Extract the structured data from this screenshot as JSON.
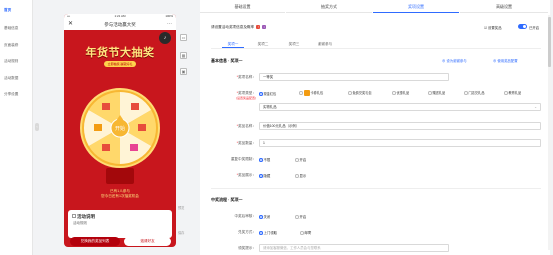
{
  "sidebar": {
    "items": [
      {
        "label": "首页",
        "active": true
      },
      {
        "label": "基础信息"
      },
      {
        "label": "页面装修"
      },
      {
        "label": "活动规则"
      },
      {
        "label": "活动数据"
      },
      {
        "label": "分享设置"
      }
    ]
  },
  "phone": {
    "time": "1:21 AM",
    "battery": "100%",
    "nav_title": "参与活动赢大奖",
    "banner_title": "年货节大抽奖",
    "banner_sub": "立即抽奖 赢取好礼",
    "wheel_center": "开始",
    "prize_line1": "已有1人参与",
    "prize_line2": "您今日还有1次抽奖机会",
    "rules_title": "活动说明",
    "rules_sub": "活动规则",
    "btn_primary": "兑换我的奖品列表",
    "btn_secondary": "邀请好友"
  },
  "tools": {
    "labels": [
      "预览",
      "保存"
    ]
  },
  "tabs": [
    {
      "label": "基础设置"
    },
    {
      "label": "抽奖方式"
    },
    {
      "label": "奖项设置",
      "active": true
    },
    {
      "label": "高级设置"
    }
  ],
  "notice": {
    "text": "请设置活动奖项信息及概率",
    "checkbox_label": "设置奖品",
    "toggle_label": "已开启"
  },
  "prize_tabs": [
    {
      "label": "奖项一",
      "active": true
    },
    {
      "label": "奖项二"
    },
    {
      "label": "奖项三"
    },
    {
      "label": "谢谢参与"
    }
  ],
  "section1": {
    "title": "基本信息 · 奖项一",
    "link_set_default": "设为谢谢参与",
    "link_use_config": "使用奖品配置",
    "fields": {
      "name_label": "奖项名称：",
      "name_value": "一等奖",
      "type_label": "奖项类型：",
      "type_hint": "(设置奖品配置)",
      "type_options": [
        {
          "label": "现金红包",
          "on": true,
          "color": "#e74c3c"
        },
        {
          "label": "卡券礼包",
          "color": "#f39c12"
        },
        {
          "label": "免费兑奖礼包",
          "color": "#f39c12"
        },
        {
          "label": "优惠礼品",
          "color": "#e67e22"
        },
        {
          "label": "赠送礼品",
          "color": "#3498db"
        },
        {
          "label": "门店兑礼品",
          "color": "#2ecc71"
        },
        {
          "label": "教育礼品",
          "color": "#9b59b6"
        }
      ],
      "select_value": "实物礼品",
      "reward_label": "奖品名称：",
      "reward_value": "价值100元礼品（示例）",
      "qty_label": "奖品数量：",
      "qty_value": "1",
      "limit_label": "重复中奖限制：",
      "limit_options": [
        {
          "label": "不限",
          "on": true
        },
        {
          "label": "开启"
        }
      ],
      "show_label": "奖品展示：",
      "show_options": [
        {
          "label": "隐藏",
          "on": true
        },
        {
          "label": "显示"
        }
      ]
    }
  },
  "section2": {
    "title": "中奖流程 · 奖项一",
    "fields": {
      "review_label": "中奖后审核：",
      "review_options": [
        {
          "label": "关闭",
          "on": true
        },
        {
          "label": "开启"
        }
      ],
      "method_label": "兑奖方式：",
      "method_options": [
        {
          "label": "上门领取",
          "on": true
        },
        {
          "label": "邮寄"
        }
      ],
      "tip_label": "领奖提示：",
      "tip_placeholder": "请添加客服微信，工作人员会与您联系"
    }
  }
}
